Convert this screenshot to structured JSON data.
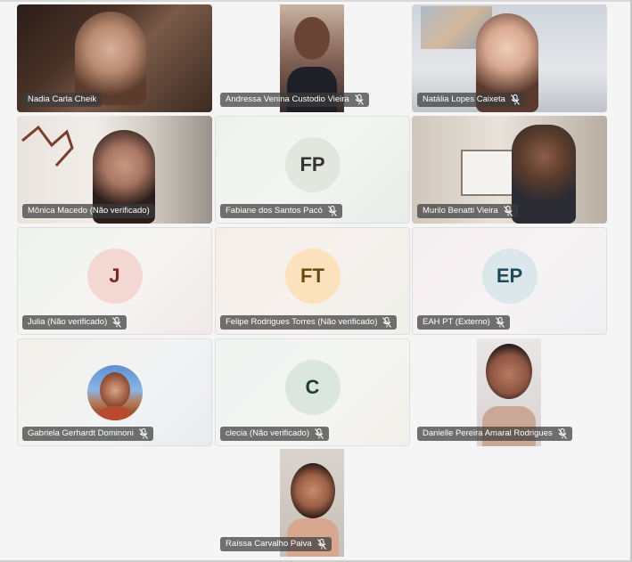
{
  "participants": [
    {
      "name": "Nadia Carla Cheik",
      "type": "video",
      "muted": false
    },
    {
      "name": "Andressa Venina Custodio Vieira",
      "type": "video",
      "muted": true
    },
    {
      "name": "Natália Lopes Caixeta",
      "type": "video",
      "muted": true
    },
    {
      "name": "Mônica Macedo (Não verificado)",
      "type": "video",
      "muted": false
    },
    {
      "name": "Fabiane dos Santos Pacó",
      "type": "avatar",
      "initials": "FP",
      "muted": true
    },
    {
      "name": "Murilo Benatti Vieira",
      "type": "video",
      "muted": true
    },
    {
      "name": "Julia (Não verificado)",
      "type": "avatar",
      "initials": "J",
      "muted": true
    },
    {
      "name": "Felipe Rodrigues Torres (Não verificado)",
      "type": "avatar",
      "initials": "FT",
      "muted": true
    },
    {
      "name": "EAH PT (Externo)",
      "type": "avatar",
      "initials": "EP",
      "muted": true
    },
    {
      "name": "Gabriela Gerhardt Dominoni",
      "type": "photo-avatar",
      "muted": true
    },
    {
      "name": "clecia (Não verificado)",
      "type": "avatar",
      "initials": "C",
      "muted": true
    },
    {
      "name": "Danielle Pereira Amaral Rodrigues",
      "type": "video",
      "muted": true
    },
    {
      "name": "Raíssa Carvalho Paiva",
      "type": "video",
      "muted": true
    }
  ],
  "colors": {
    "name_bar_bg": "#3c3c3c",
    "avatar_fp": "#e3e6de",
    "avatar_j": "#f3d7d2",
    "avatar_ft": "#fbe2bd",
    "avatar_ep": "#dce7ec",
    "avatar_c": "#dbe6e0"
  }
}
